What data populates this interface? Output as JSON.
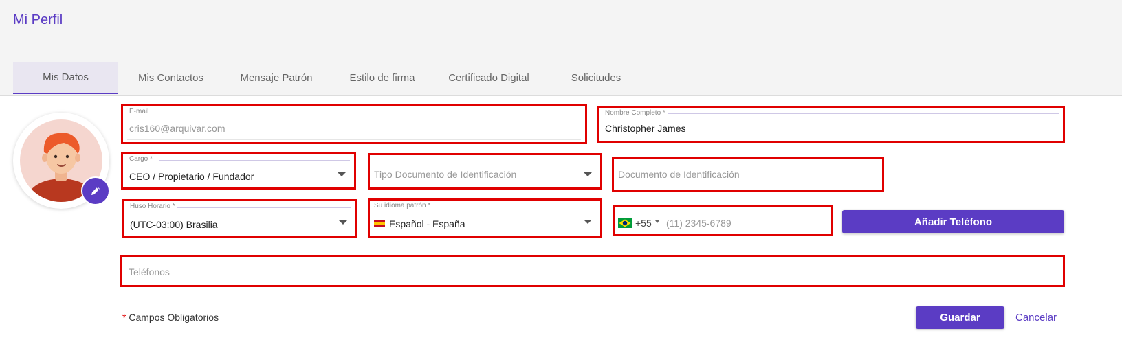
{
  "page": {
    "title": "Mi Perfil"
  },
  "tabs": [
    {
      "label": "Mis Datos"
    },
    {
      "label": "Mis Contactos"
    },
    {
      "label": "Mensaje Patrón"
    },
    {
      "label": "Estilo de firma"
    },
    {
      "label": "Certificado Digital"
    },
    {
      "label": "Solicitudes"
    }
  ],
  "form": {
    "email": {
      "label": "E-mail",
      "value": "cris160@arquivar.com"
    },
    "full_name": {
      "label": "Nombre Completo *",
      "value": "Christopher James"
    },
    "cargo": {
      "label": "Cargo *",
      "value": "CEO / Propietario / Fundador"
    },
    "id_doc_type": {
      "placeholder": "Tipo Documento de Identificación"
    },
    "id_doc": {
      "placeholder": "Documento de Identificación"
    },
    "timezone": {
      "label": "Huso Horario *",
      "value": "(UTC-03:00) Brasilia"
    },
    "language": {
      "label": "Su idioma patrón *",
      "value": "Español - España",
      "flag_icon": "spain-flag-icon"
    },
    "phone": {
      "country_code": "+55",
      "placeholder": "(11) 2345-6789",
      "flag_icon": "brazil-flag-icon"
    },
    "add_phone_label": "Añadir Teléfono",
    "phones": {
      "placeholder": "Teléfonos"
    }
  },
  "footer": {
    "required_star": "*",
    "required_note": "Campos Obligatorios",
    "save_label": "Guardar",
    "cancel_label": "Cancelar"
  },
  "colors": {
    "accent": "#5b3cc4",
    "highlight_border": "#e00000"
  }
}
